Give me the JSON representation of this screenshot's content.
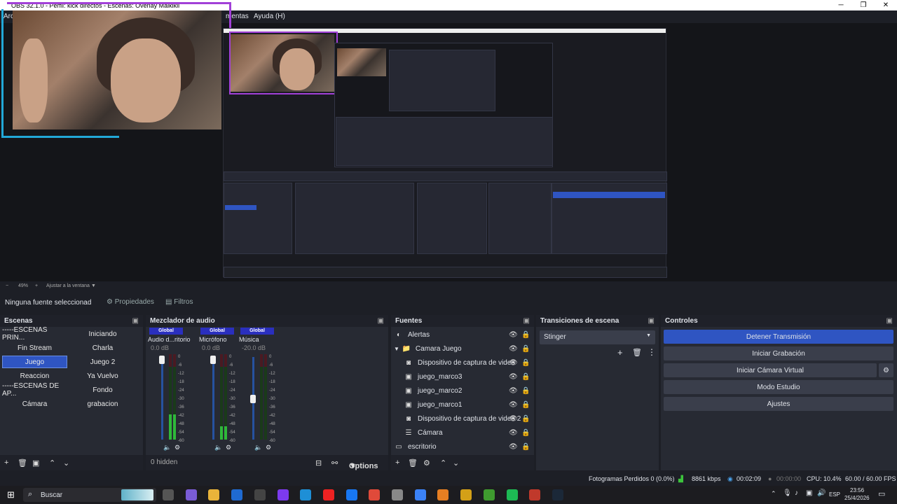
{
  "window": {
    "title": "OBS 32.1.0 - Perfil: kick directos - Escenas: Overlay Maikikii",
    "minimize": "─",
    "maximize": "❐",
    "close": "✕"
  },
  "menu": {
    "item_left": "Arc",
    "item_tools": "mentas",
    "item_help": "Ayuda (H)"
  },
  "preview": {
    "zoom_minus": "−",
    "zoom_value": "49%",
    "zoom_plus": "+",
    "fit_label": "Ajustar a la ventana"
  },
  "properties_bar": {
    "no_source": "Ninguna fuente seleccionad",
    "properties_label": "Propiedades",
    "filters_label": "Filtros"
  },
  "scenes": {
    "title": "Escenas",
    "col1": [
      "-----ESCENAS PRIN...",
      "Fin Stream",
      "Juego",
      "Reaccion",
      "-----ESCENAS DE AP...",
      "Cámara"
    ],
    "col2": [
      "Iniciando",
      "Charla",
      "Juego 2",
      "Ya Vuelvo",
      "Fondo",
      "grabacion"
    ],
    "selected": "Juego"
  },
  "mixer": {
    "title": "Mezclador de audio",
    "global_badge": "Global",
    "channels": [
      {
        "name": "Audio d...ritorio",
        "db": "0.0 dB",
        "level": 0.85
      },
      {
        "name": "Micrófono",
        "db": "0.0 dB",
        "level": 0.45
      },
      {
        "name": "Música",
        "db": "-20.0 dB",
        "level": 0.0
      }
    ],
    "scale": [
      "0",
      "-6",
      "-12",
      "-18",
      "-24",
      "-30",
      "-36",
      "-42",
      "-48",
      "-54",
      "-60"
    ],
    "hidden": "0 hidden",
    "options": "Options"
  },
  "sources": {
    "title": "Fuentes",
    "items": [
      {
        "label": "Alertas",
        "icon": "◐"
      },
      {
        "label": "Camara Juego",
        "icon": "📁"
      },
      {
        "label": "Dispositivo de captura de video",
        "icon": "◙"
      },
      {
        "label": "juego_marco3",
        "icon": "▣"
      },
      {
        "label": "juego_marco2",
        "icon": "▣"
      },
      {
        "label": "juego_marco1",
        "icon": "▣"
      },
      {
        "label": "Dispositivo de captura de video 2",
        "icon": "◙"
      },
      {
        "label": "Cámara",
        "icon": "☰"
      },
      {
        "label": "escritorio",
        "icon": "▭"
      }
    ]
  },
  "transitions": {
    "title": "Transiciones de escena",
    "selected": "Stinger"
  },
  "controls": {
    "title": "Controles",
    "stop_stream": "Detener Transmisión",
    "start_recording": "Iniciar Grabación",
    "virtual_cam": "Iniciar Cámara Virtual",
    "studio_mode": "Modo Estudio",
    "settings": "Ajustes"
  },
  "status": {
    "dropped_frames": "Fotogramas Perdidos 0 (0.0%)",
    "bitrate": "8861 kbps",
    "stream_time": "00:02:09",
    "rec_time": "00:00:00",
    "cpu": "CPU: 10.4%",
    "fps": "60.00 / 60.00 FPS"
  },
  "taskbar": {
    "search": "Buscar",
    "lang": "ESP",
    "time": "23:56",
    "date": "25/4/2026"
  },
  "colors": {
    "accent": "#2f55c2",
    "panel": "#272a33",
    "background": "#1d1f26"
  }
}
